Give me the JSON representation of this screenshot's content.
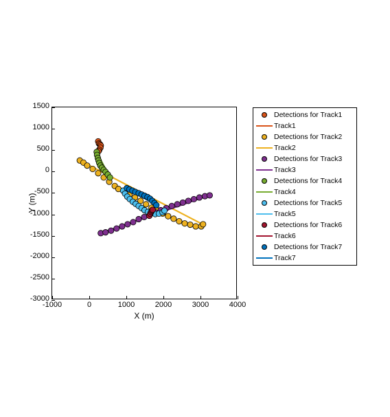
{
  "chart_data": {
    "type": "scatter",
    "xlabel": "X (m)",
    "ylabel": "Y (m)",
    "xlim": [
      -1000,
      4000
    ],
    "ylim": [
      1500,
      -3000
    ],
    "xticks": [
      -1000,
      0,
      1000,
      2000,
      3000,
      4000
    ],
    "yticks": [
      -3000,
      -2500,
      -2000,
      -1500,
      -1000,
      -500,
      0,
      500,
      1000,
      1500
    ],
    "legend": [
      "Detections for Track1",
      "Track1",
      "Detections for Track2",
      "Track2",
      "Detections for Track3",
      "Track3",
      "Detections for Track4",
      "Track4",
      "Detections for Track5",
      "Track5",
      "Detections for Track6",
      "Track6",
      "Detections for Track7",
      "Track7"
    ],
    "colors": {
      "track1": {
        "fill": "#D95319",
        "edge": "#000"
      },
      "track2": {
        "fill": "#EDB120",
        "edge": "#000"
      },
      "track3": {
        "fill": "#7E2F8E",
        "edge": "#000"
      },
      "track4": {
        "fill": "#77AC30",
        "edge": "#000"
      },
      "track5": {
        "fill": "#4DBEEE",
        "edge": "#000"
      },
      "track6": {
        "fill": "#A2142F",
        "edge": "#000"
      },
      "track7": {
        "fill": "#0072BD",
        "edge": "#000"
      }
    },
    "series": [
      {
        "name": "Detections for Track1",
        "track": "track1",
        "kind": "marker",
        "data": [
          [
            250,
            700
          ],
          [
            270,
            650
          ],
          [
            300,
            630
          ],
          [
            320,
            600
          ],
          [
            310,
            550
          ],
          [
            280,
            500
          ],
          [
            260,
            470
          ]
        ]
      },
      {
        "name": "Track1",
        "track": "track1",
        "kind": "line",
        "data": [
          [
            240,
            720
          ],
          [
            300,
            500
          ]
        ]
      },
      {
        "name": "Detections for Track2",
        "track": "track2",
        "kind": "marker",
        "data": [
          [
            -250,
            250
          ],
          [
            -150,
            200
          ],
          [
            -50,
            130
          ],
          [
            100,
            50
          ],
          [
            250,
            -50
          ],
          [
            400,
            -150
          ],
          [
            550,
            -250
          ],
          [
            700,
            -350
          ],
          [
            800,
            -420
          ],
          [
            950,
            -470
          ],
          [
            1100,
            -550
          ],
          [
            1250,
            -620
          ],
          [
            1400,
            -700
          ],
          [
            1550,
            -780
          ],
          [
            1700,
            -860
          ],
          [
            1850,
            -920
          ],
          [
            2000,
            -1000
          ],
          [
            2150,
            -1060
          ],
          [
            2300,
            -1120
          ],
          [
            2450,
            -1180
          ],
          [
            2600,
            -1230
          ],
          [
            2750,
            -1260
          ],
          [
            2900,
            -1300
          ],
          [
            3050,
            -1300
          ],
          [
            3100,
            -1250
          ]
        ]
      },
      {
        "name": "Track2",
        "track": "track2",
        "kind": "line",
        "data": [
          [
            -250,
            250
          ],
          [
            3150,
            -1280
          ]
        ]
      },
      {
        "name": "Detections for Track3",
        "track": "track3",
        "kind": "marker",
        "data": [
          [
            320,
            -1460
          ],
          [
            450,
            -1440
          ],
          [
            600,
            -1400
          ],
          [
            750,
            -1350
          ],
          [
            900,
            -1300
          ],
          [
            1050,
            -1250
          ],
          [
            1200,
            -1200
          ],
          [
            1350,
            -1130
          ],
          [
            1500,
            -1080
          ],
          [
            1650,
            -1020
          ],
          [
            1800,
            -970
          ],
          [
            1950,
            -920
          ],
          [
            2100,
            -870
          ],
          [
            2250,
            -820
          ],
          [
            2400,
            -780
          ],
          [
            2550,
            -740
          ],
          [
            2700,
            -700
          ],
          [
            2850,
            -660
          ],
          [
            3000,
            -620
          ],
          [
            3150,
            -590
          ],
          [
            3280,
            -570
          ]
        ]
      },
      {
        "name": "Track3",
        "track": "track3",
        "kind": "line",
        "data": [
          [
            300,
            -1470
          ],
          [
            3300,
            -560
          ]
        ]
      },
      {
        "name": "Detections for Track4",
        "track": "track4",
        "kind": "marker",
        "data": [
          [
            210,
            450
          ],
          [
            220,
            380
          ],
          [
            240,
            310
          ],
          [
            260,
            250
          ],
          [
            280,
            190
          ],
          [
            310,
            130
          ],
          [
            350,
            80
          ],
          [
            400,
            30
          ],
          [
            450,
            -20
          ],
          [
            510,
            -80
          ],
          [
            570,
            -150
          ]
        ]
      },
      {
        "name": "Track4",
        "track": "track4",
        "kind": "line",
        "data": [
          [
            200,
            460
          ],
          [
            580,
            -160
          ]
        ]
      },
      {
        "name": "Detections for Track5",
        "track": "track5",
        "kind": "marker",
        "data": [
          [
            930,
            -460
          ],
          [
            980,
            -530
          ],
          [
            1040,
            -600
          ],
          [
            1110,
            -660
          ],
          [
            1190,
            -720
          ],
          [
            1270,
            -770
          ],
          [
            1350,
            -820
          ],
          [
            1430,
            -870
          ],
          [
            1510,
            -920
          ],
          [
            1600,
            -960
          ],
          [
            1700,
            -990
          ],
          [
            1800,
            -1010
          ],
          [
            1900,
            -1000
          ],
          [
            2000,
            -970
          ],
          [
            2050,
            -930
          ]
        ]
      },
      {
        "name": "Track5",
        "track": "track5",
        "kind": "line",
        "data": [
          [
            920,
            -450
          ],
          [
            1500,
            -920
          ],
          [
            2060,
            -920
          ]
        ]
      },
      {
        "name": "Detections for Track6",
        "track": "track6",
        "kind": "marker",
        "data": [
          [
            1640,
            -1050
          ],
          [
            1665,
            -1000
          ],
          [
            1690,
            -960
          ],
          [
            1710,
            -930
          ],
          [
            1730,
            -910
          ]
        ]
      },
      {
        "name": "Track6",
        "track": "track6",
        "kind": "line",
        "data": [
          [
            1630,
            -1060
          ],
          [
            1740,
            -900
          ]
        ]
      },
      {
        "name": "Detections for Track7",
        "track": "track7",
        "kind": "marker",
        "data": [
          [
            1030,
            -400
          ],
          [
            1100,
            -430
          ],
          [
            1180,
            -460
          ],
          [
            1260,
            -490
          ],
          [
            1350,
            -520
          ],
          [
            1430,
            -550
          ],
          [
            1510,
            -580
          ],
          [
            1590,
            -610
          ],
          [
            1660,
            -650
          ],
          [
            1720,
            -700
          ],
          [
            1780,
            -750
          ],
          [
            1830,
            -800
          ]
        ]
      },
      {
        "name": "Track7",
        "track": "track7",
        "kind": "line",
        "data": [
          [
            1020,
            -390
          ],
          [
            1840,
            -810
          ]
        ]
      }
    ]
  }
}
